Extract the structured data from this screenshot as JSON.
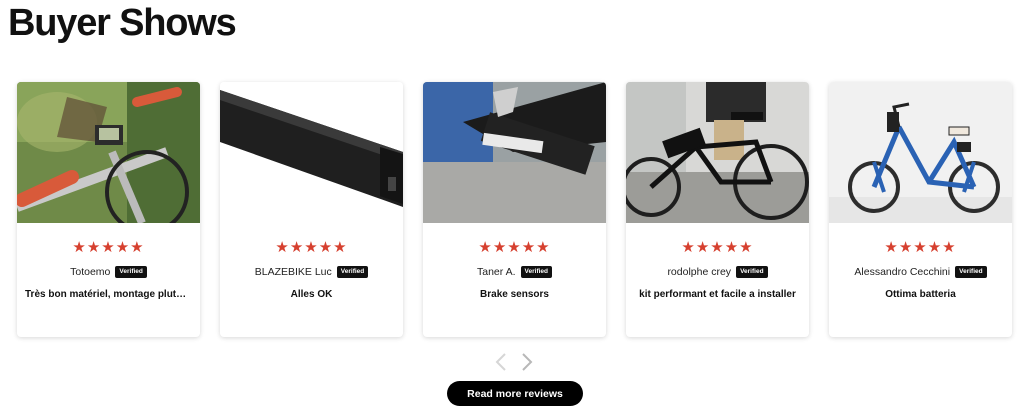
{
  "header": {
    "title": "Buyer Shows"
  },
  "reviews": [
    {
      "rating": 5,
      "stars": "★★★★★",
      "name": "Totoemo",
      "verified": "Verified",
      "text": "Très bon matériel, montage plutôt simple",
      "photo": "bike-handlebar-photo"
    },
    {
      "rating": 5,
      "stars": "★★★★★",
      "name": "BLAZEBIKE Luc",
      "verified": "Verified",
      "text": "Alles OK",
      "photo": "battery-photo"
    },
    {
      "rating": 5,
      "stars": "★★★★★",
      "name": "Taner A.",
      "verified": "Verified",
      "text": "Brake sensors",
      "photo": "brake-sensor-photo"
    },
    {
      "rating": 5,
      "stars": "★★★★★",
      "name": "rodolphe crey",
      "verified": "Verified",
      "text": "kit performant et facile a installer",
      "photo": "ebike-rider-photo"
    },
    {
      "rating": 5,
      "stars": "★★★★★",
      "name": "Alessandro Cecchini",
      "verified": "Verified",
      "text": "Ottima batteria",
      "photo": "blue-bike-photo"
    }
  ],
  "pager": {
    "prev_icon": "chevron-left-icon",
    "next_icon": "chevron-right-icon"
  },
  "footer": {
    "read_more_label": "Read more reviews"
  },
  "colors": {
    "star": "#d6402f",
    "badge": "#111111",
    "button": "#000000"
  }
}
